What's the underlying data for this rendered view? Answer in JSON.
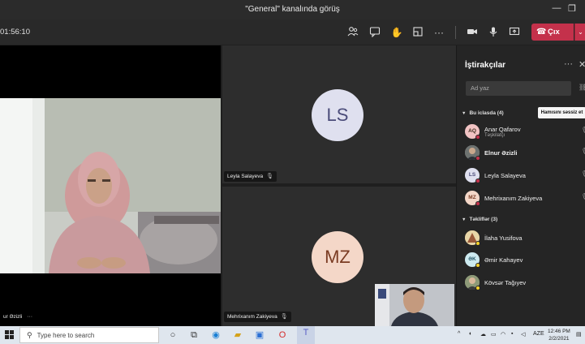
{
  "window": {
    "title": "\"General\" kanalında görüş"
  },
  "toolbar": {
    "timer": "01:56:10",
    "leave_label": "Çıx"
  },
  "stage": {
    "main_participant": "ur Əzizli",
    "main_more": "···",
    "tiles": [
      {
        "initials": "LS",
        "name": "Leyla Salayeva",
        "color": "#dfe0ef",
        "text_color": "#4b4c7a"
      },
      {
        "initials": "MZ",
        "name": "Mehrixanım Zakiyeva",
        "color": "#f4d7c8",
        "text_color": "#7a3b22"
      }
    ]
  },
  "participants_panel": {
    "title": "İştirakçılar",
    "search_placeholder": "Ad yaz",
    "mute_all_label": "Hamısını səssiz et",
    "in_meeting_header": "Bu iclasda (4)",
    "in_meeting": [
      {
        "initials": "AQ",
        "name": "Anar Qafarov",
        "role": "Təşkilatçı",
        "avatar_color": "#f2c4c4",
        "status_color": "#c4314b",
        "mic": "🎙"
      },
      {
        "initials": "",
        "name": "Elnur Əzizli",
        "role": "",
        "avatar_color": "#8a8a8a",
        "status_color": "#c4314b",
        "mic": "🎙",
        "bold": true
      },
      {
        "initials": "LS",
        "name": "Leyla Salayeva",
        "role": "",
        "avatar_color": "#dfe0ef",
        "status_color": "#c4314b",
        "mic": "🎙"
      },
      {
        "initials": "MZ",
        "name": "Mehrixanım Zakiyeva",
        "role": "",
        "avatar_color": "#f4d7c8",
        "status_color": "#c4314b",
        "mic": "🎙"
      }
    ],
    "suggested_header": "Təkliflər (3)",
    "suggested": [
      {
        "initials": "",
        "name": "İlaha Yusifova",
        "avatar_color": "#b58a5a",
        "status_color": "#f8d22a"
      },
      {
        "initials": "ƏK",
        "name": "Əmir Kahayev",
        "avatar_color": "#cdeaf0",
        "status_color": "#f8d22a"
      },
      {
        "initials": "",
        "name": "Kövsər Tağıyev",
        "avatar_color": "#7d8a6a",
        "status_color": "#f8d22a"
      }
    ]
  },
  "taskbar": {
    "search_placeholder": "Type here to search",
    "language": "AZE",
    "time": "12:46 PM",
    "date": "2/2/2021"
  }
}
